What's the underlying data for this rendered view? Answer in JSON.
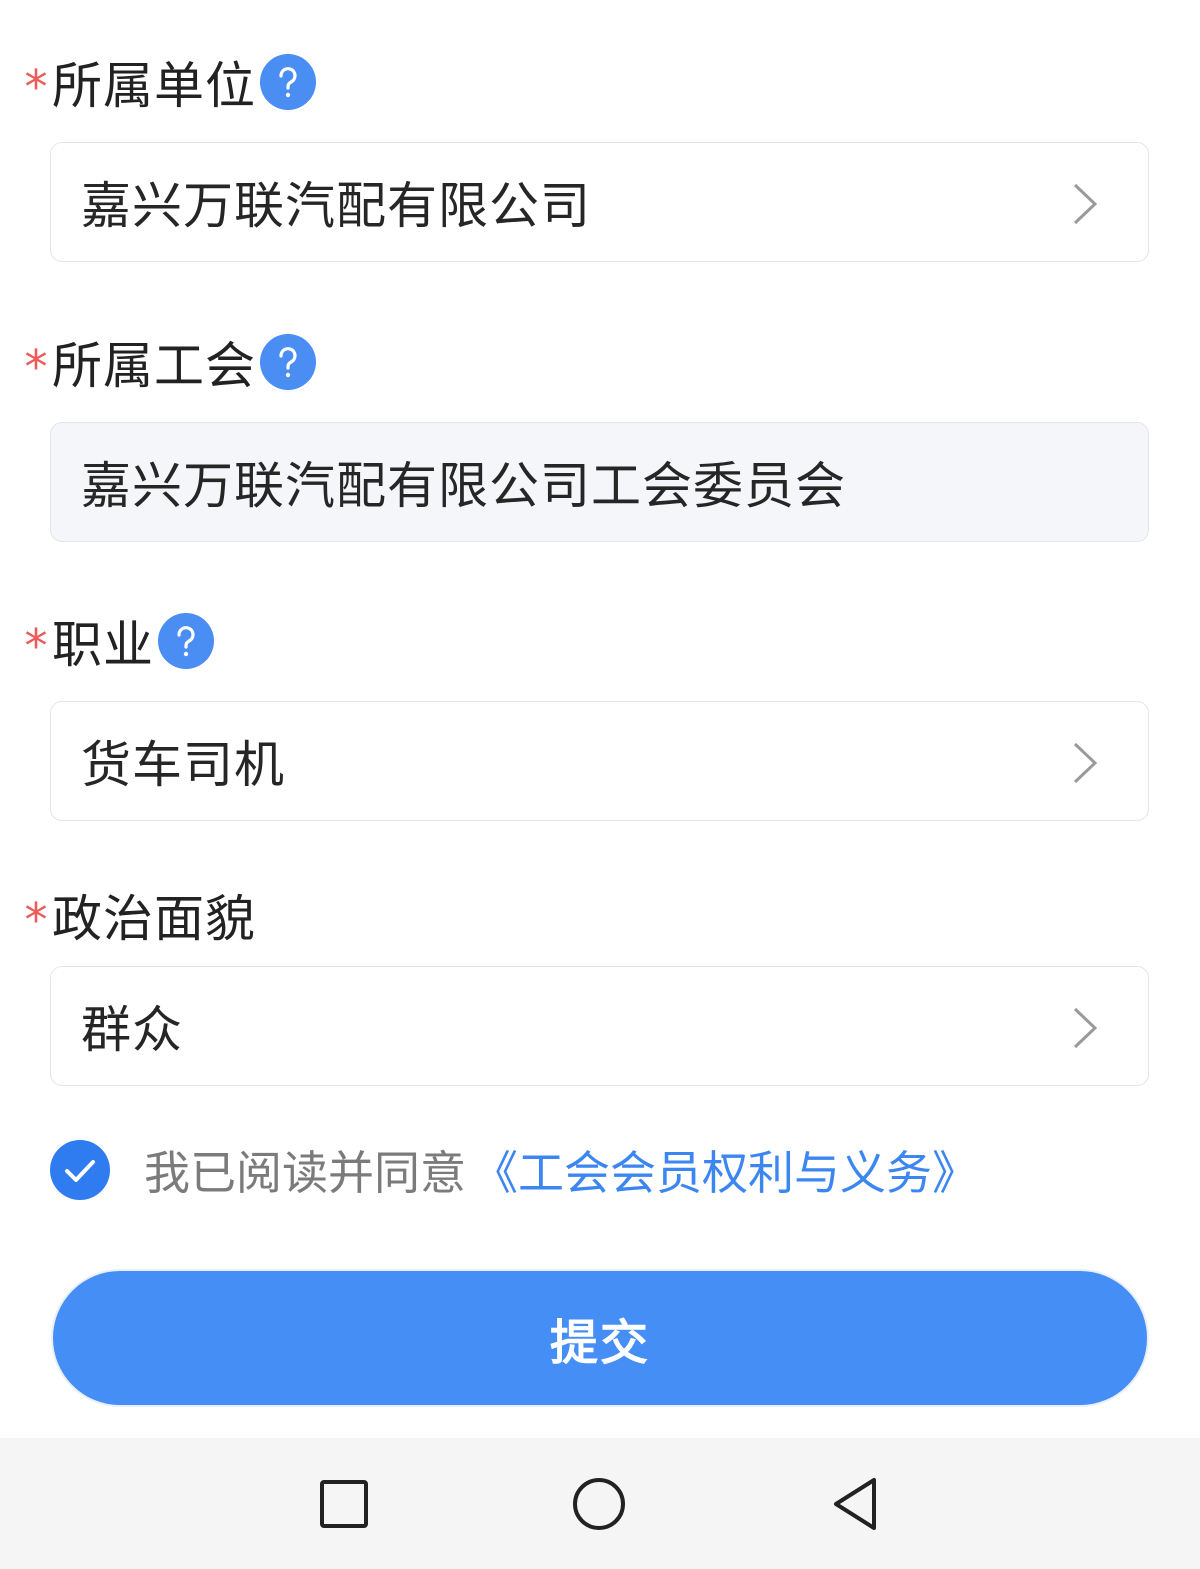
{
  "fields": [
    {
      "label": "所属单位",
      "required_mark": "*",
      "has_help": true,
      "value": "嘉兴万联汽配有限公司",
      "selectable": true
    },
    {
      "label": "所属工会",
      "required_mark": "*",
      "has_help": true,
      "value": "嘉兴万联汽配有限公司工会委员会",
      "selectable": false
    },
    {
      "label": "职业",
      "required_mark": "*",
      "has_help": true,
      "value": "货车司机",
      "selectable": true
    },
    {
      "label": "政治面貌",
      "required_mark": "*",
      "has_help": false,
      "value": "群众",
      "selectable": true
    }
  ],
  "agreement": {
    "checked": true,
    "text": "我已阅读并同意",
    "link_text": "《工会会员权利与义务》"
  },
  "submit_label": "提交",
  "nav": {
    "recent_icon": "square-icon",
    "home_icon": "circle-icon",
    "back_icon": "triangle-back-icon"
  },
  "colors": {
    "accent": "#448ef6",
    "required": "#ec5a5a",
    "link": "#3c86f2"
  }
}
